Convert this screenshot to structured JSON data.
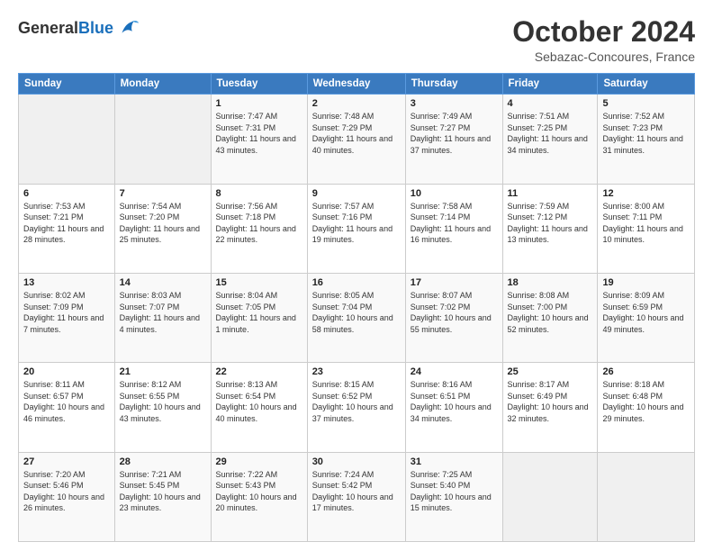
{
  "header": {
    "logo_general": "General",
    "logo_blue": "Blue",
    "month_title": "October 2024",
    "subtitle": "Sebazac-Concoures, France"
  },
  "weekdays": [
    "Sunday",
    "Monday",
    "Tuesday",
    "Wednesday",
    "Thursday",
    "Friday",
    "Saturday"
  ],
  "weeks": [
    [
      {
        "day": "",
        "sunrise": "",
        "sunset": "",
        "daylight": ""
      },
      {
        "day": "",
        "sunrise": "",
        "sunset": "",
        "daylight": ""
      },
      {
        "day": "1",
        "sunrise": "Sunrise: 7:47 AM",
        "sunset": "Sunset: 7:31 PM",
        "daylight": "Daylight: 11 hours and 43 minutes."
      },
      {
        "day": "2",
        "sunrise": "Sunrise: 7:48 AM",
        "sunset": "Sunset: 7:29 PM",
        "daylight": "Daylight: 11 hours and 40 minutes."
      },
      {
        "day": "3",
        "sunrise": "Sunrise: 7:49 AM",
        "sunset": "Sunset: 7:27 PM",
        "daylight": "Daylight: 11 hours and 37 minutes."
      },
      {
        "day": "4",
        "sunrise": "Sunrise: 7:51 AM",
        "sunset": "Sunset: 7:25 PM",
        "daylight": "Daylight: 11 hours and 34 minutes."
      },
      {
        "day": "5",
        "sunrise": "Sunrise: 7:52 AM",
        "sunset": "Sunset: 7:23 PM",
        "daylight": "Daylight: 11 hours and 31 minutes."
      }
    ],
    [
      {
        "day": "6",
        "sunrise": "Sunrise: 7:53 AM",
        "sunset": "Sunset: 7:21 PM",
        "daylight": "Daylight: 11 hours and 28 minutes."
      },
      {
        "day": "7",
        "sunrise": "Sunrise: 7:54 AM",
        "sunset": "Sunset: 7:20 PM",
        "daylight": "Daylight: 11 hours and 25 minutes."
      },
      {
        "day": "8",
        "sunrise": "Sunrise: 7:56 AM",
        "sunset": "Sunset: 7:18 PM",
        "daylight": "Daylight: 11 hours and 22 minutes."
      },
      {
        "day": "9",
        "sunrise": "Sunrise: 7:57 AM",
        "sunset": "Sunset: 7:16 PM",
        "daylight": "Daylight: 11 hours and 19 minutes."
      },
      {
        "day": "10",
        "sunrise": "Sunrise: 7:58 AM",
        "sunset": "Sunset: 7:14 PM",
        "daylight": "Daylight: 11 hours and 16 minutes."
      },
      {
        "day": "11",
        "sunrise": "Sunrise: 7:59 AM",
        "sunset": "Sunset: 7:12 PM",
        "daylight": "Daylight: 11 hours and 13 minutes."
      },
      {
        "day": "12",
        "sunrise": "Sunrise: 8:00 AM",
        "sunset": "Sunset: 7:11 PM",
        "daylight": "Daylight: 11 hours and 10 minutes."
      }
    ],
    [
      {
        "day": "13",
        "sunrise": "Sunrise: 8:02 AM",
        "sunset": "Sunset: 7:09 PM",
        "daylight": "Daylight: 11 hours and 7 minutes."
      },
      {
        "day": "14",
        "sunrise": "Sunrise: 8:03 AM",
        "sunset": "Sunset: 7:07 PM",
        "daylight": "Daylight: 11 hours and 4 minutes."
      },
      {
        "day": "15",
        "sunrise": "Sunrise: 8:04 AM",
        "sunset": "Sunset: 7:05 PM",
        "daylight": "Daylight: 11 hours and 1 minute."
      },
      {
        "day": "16",
        "sunrise": "Sunrise: 8:05 AM",
        "sunset": "Sunset: 7:04 PM",
        "daylight": "Daylight: 10 hours and 58 minutes."
      },
      {
        "day": "17",
        "sunrise": "Sunrise: 8:07 AM",
        "sunset": "Sunset: 7:02 PM",
        "daylight": "Daylight: 10 hours and 55 minutes."
      },
      {
        "day": "18",
        "sunrise": "Sunrise: 8:08 AM",
        "sunset": "Sunset: 7:00 PM",
        "daylight": "Daylight: 10 hours and 52 minutes."
      },
      {
        "day": "19",
        "sunrise": "Sunrise: 8:09 AM",
        "sunset": "Sunset: 6:59 PM",
        "daylight": "Daylight: 10 hours and 49 minutes."
      }
    ],
    [
      {
        "day": "20",
        "sunrise": "Sunrise: 8:11 AM",
        "sunset": "Sunset: 6:57 PM",
        "daylight": "Daylight: 10 hours and 46 minutes."
      },
      {
        "day": "21",
        "sunrise": "Sunrise: 8:12 AM",
        "sunset": "Sunset: 6:55 PM",
        "daylight": "Daylight: 10 hours and 43 minutes."
      },
      {
        "day": "22",
        "sunrise": "Sunrise: 8:13 AM",
        "sunset": "Sunset: 6:54 PM",
        "daylight": "Daylight: 10 hours and 40 minutes."
      },
      {
        "day": "23",
        "sunrise": "Sunrise: 8:15 AM",
        "sunset": "Sunset: 6:52 PM",
        "daylight": "Daylight: 10 hours and 37 minutes."
      },
      {
        "day": "24",
        "sunrise": "Sunrise: 8:16 AM",
        "sunset": "Sunset: 6:51 PM",
        "daylight": "Daylight: 10 hours and 34 minutes."
      },
      {
        "day": "25",
        "sunrise": "Sunrise: 8:17 AM",
        "sunset": "Sunset: 6:49 PM",
        "daylight": "Daylight: 10 hours and 32 minutes."
      },
      {
        "day": "26",
        "sunrise": "Sunrise: 8:18 AM",
        "sunset": "Sunset: 6:48 PM",
        "daylight": "Daylight: 10 hours and 29 minutes."
      }
    ],
    [
      {
        "day": "27",
        "sunrise": "Sunrise: 7:20 AM",
        "sunset": "Sunset: 5:46 PM",
        "daylight": "Daylight: 10 hours and 26 minutes."
      },
      {
        "day": "28",
        "sunrise": "Sunrise: 7:21 AM",
        "sunset": "Sunset: 5:45 PM",
        "daylight": "Daylight: 10 hours and 23 minutes."
      },
      {
        "day": "29",
        "sunrise": "Sunrise: 7:22 AM",
        "sunset": "Sunset: 5:43 PM",
        "daylight": "Daylight: 10 hours and 20 minutes."
      },
      {
        "day": "30",
        "sunrise": "Sunrise: 7:24 AM",
        "sunset": "Sunset: 5:42 PM",
        "daylight": "Daylight: 10 hours and 17 minutes."
      },
      {
        "day": "31",
        "sunrise": "Sunrise: 7:25 AM",
        "sunset": "Sunset: 5:40 PM",
        "daylight": "Daylight: 10 hours and 15 minutes."
      },
      {
        "day": "",
        "sunrise": "",
        "sunset": "",
        "daylight": ""
      },
      {
        "day": "",
        "sunrise": "",
        "sunset": "",
        "daylight": ""
      }
    ]
  ]
}
